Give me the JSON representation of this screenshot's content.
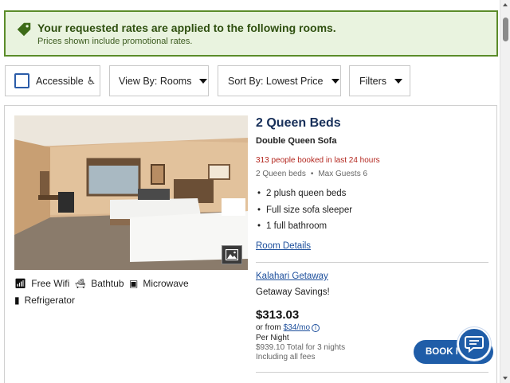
{
  "banner": {
    "title": "Your requested rates are applied to the following rooms.",
    "subtitle": "Prices shown include promotional rates.",
    "icon": "tag-icon",
    "accent": "#5b8c2a"
  },
  "filters": {
    "accessible_label": "Accessible",
    "accessible_checked": false,
    "view_by": "View By: Rooms",
    "sort_by": "Sort By: Lowest Price",
    "filters_label": "Filters"
  },
  "room": {
    "name": "2 Queen Beds",
    "subname": "Double Queen Sofa",
    "booked_notice": "313 people booked in last 24 hours",
    "beds": "2 Queen beds",
    "max_guests": "Max Guests 6",
    "features": [
      "2 plush queen beds",
      "Full size sofa sleeper",
      "1 full bathroom"
    ],
    "details_link": "Room Details",
    "amenities": [
      {
        "icon": "wifi-icon",
        "label": "Free Wifi"
      },
      {
        "icon": "bathtub-icon",
        "label": "Bathtub"
      },
      {
        "icon": "microwave-icon",
        "label": "Microwave"
      },
      {
        "icon": "refrigerator-icon",
        "label": "Refrigerator"
      }
    ]
  },
  "rate": {
    "name": "Kalahari Getaway",
    "description": "Getaway Savings!",
    "price": "$313.03",
    "or_from": "or from",
    "monthly": "$34/mo",
    "per_night": "Per Night",
    "total": "$939.10 Total for 3 nights",
    "fees": "Including all fees",
    "book_label": "BOOK N"
  },
  "colors": {
    "brand_blue": "#1f5da8",
    "title_navy": "#18305a",
    "alert_red": "#b3261e"
  }
}
